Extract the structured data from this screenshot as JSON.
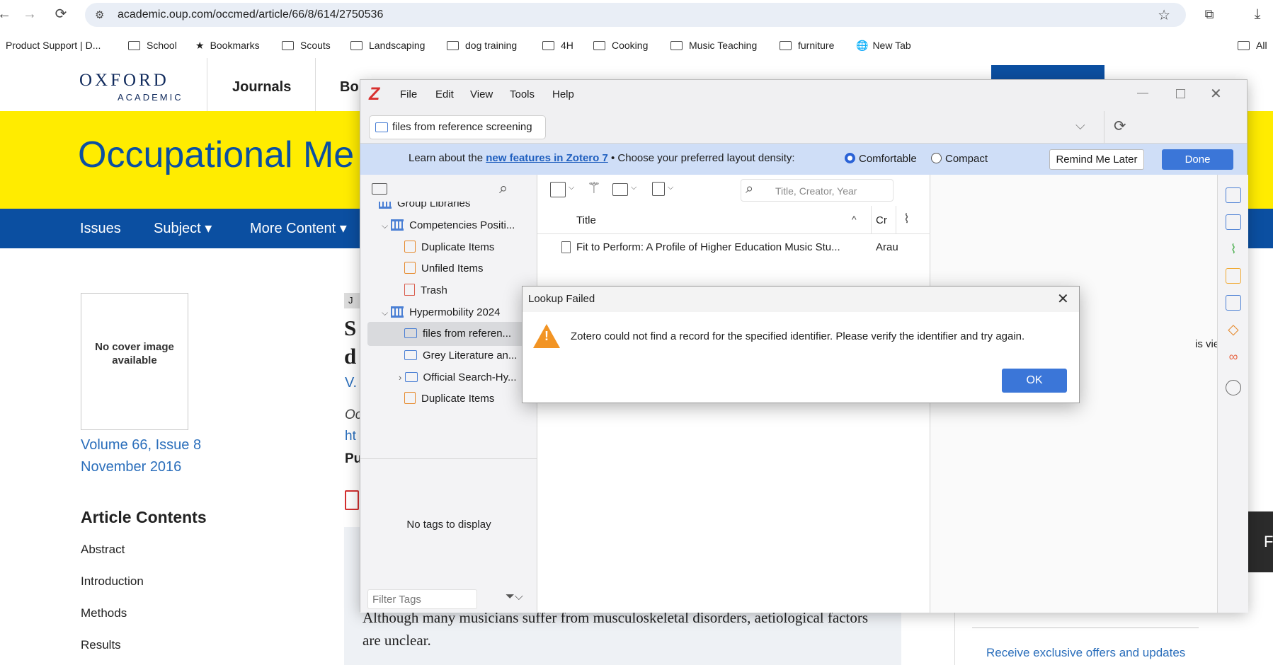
{
  "browser": {
    "url": "academic.oup.com/occmed/article/66/8/614/2750536",
    "bookmarks": [
      "Product Support | D...",
      "School",
      "Bookmarks",
      "Scouts",
      "Landscaping",
      "dog training",
      "4H",
      "Cooking",
      "Music Teaching",
      "furniture",
      "New Tab",
      "All"
    ]
  },
  "oxford": {
    "logo_top": "OXFORD",
    "logo_bottom": "ACADEMIC",
    "journals": "Journals",
    "books_partial": "Bo",
    "journal_title": "Occupational Me",
    "nav": [
      "Issues",
      "Subject ▾",
      "More Content ▾"
    ],
    "cover_text": "No cover image available",
    "volume": "Volume 66, Issue 8",
    "date": "November 2016",
    "contents_heading": "Article Contents",
    "contents": [
      "Abstract",
      "Introduction",
      "Methods",
      "Results"
    ],
    "abstract_text": "Although many musicians suffer from musculoskeletal disorders, aetiological factors are unclear.",
    "offers": "Receive exclusive offers and updates",
    "partial": [
      "J",
      "S",
      "d",
      "V.",
      "Oc",
      "ht",
      "Pu"
    ],
    "right_edge_letter": "F"
  },
  "zotero": {
    "logo": "Z",
    "menu": [
      "File",
      "Edit",
      "View",
      "Tools",
      "Help"
    ],
    "tab_label": "files from reference screening",
    "banner": {
      "lead": "Learn about the",
      "link": "new features in Zotero 7",
      "middle": "• Choose your preferred layout density:",
      "option1": "Comfortable",
      "option2": "Compact",
      "remind": "Remind Me Later",
      "done": "Done"
    },
    "collections": [
      {
        "label": "Group Libraries"
      },
      {
        "label": "Competencies Positi..."
      },
      {
        "label": "Duplicate Items"
      },
      {
        "label": "Unfiled Items"
      },
      {
        "label": "Trash"
      },
      {
        "label": "Hypermobility 2024"
      },
      {
        "label": "files from referen..."
      },
      {
        "label": "Grey Literature an..."
      },
      {
        "label": "Official Search-Hy..."
      },
      {
        "label": "Duplicate Items"
      }
    ],
    "no_tags": "No tags to display",
    "filter_placeholder": "Filter Tags",
    "search_placeholder": "Title, Creator, Year",
    "col_title": "Title",
    "col_creator": "Cr",
    "item_title": "Fit to Perform: A Profile of Higher Education Music Stu...",
    "item_creator": "Arau",
    "right_pane_text": "is view"
  },
  "dialog": {
    "title": "Lookup Failed",
    "message": "Zotero could not find a record for the specified identifier. Please verify the identifier and try again.",
    "ok": "OK"
  }
}
